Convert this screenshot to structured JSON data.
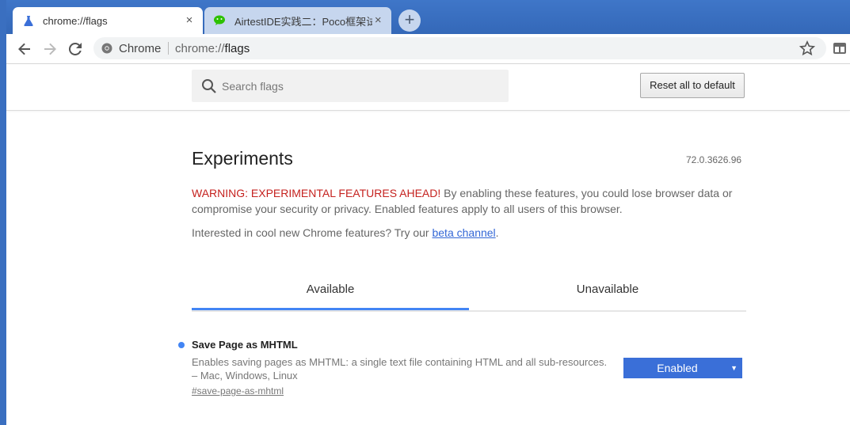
{
  "tabs": [
    {
      "title": "chrome://flags",
      "icon": "flask-icon",
      "close": "×"
    },
    {
      "title": "AirtestIDE实践二：Poco框架试用",
      "icon": "wechat-icon",
      "close": "×"
    }
  ],
  "new_tab": "+",
  "omnibox": {
    "site_label": "Chrome",
    "url_prefix": "chrome://",
    "url_path": "flags"
  },
  "search": {
    "placeholder": "Search flags",
    "value": ""
  },
  "reset_button": "Reset all to default",
  "page": {
    "title": "Experiments",
    "version": "72.0.3626.96",
    "warning_label": "WARNING: EXPERIMENTAL FEATURES AHEAD!",
    "warning_text": " By enabling these features, you could lose browser data or compromise your security or privacy. Enabled features apply to all users of this browser.",
    "interest_text": "Interested in cool new Chrome features? Try our ",
    "beta_link": "beta channel",
    "interest_end": "."
  },
  "flag_tabs": {
    "available": "Available",
    "unavailable": "Unavailable"
  },
  "experiment": {
    "name": "Save Page as MHTML",
    "description": "Enables saving pages as MHTML: a single text file containing HTML and all sub-resources.",
    "platforms": "– Mac, Windows, Linux",
    "link": "#save-page-as-mhtml",
    "selected": "Enabled",
    "arrow": "▼"
  },
  "colors": {
    "accent": "#4285f4",
    "warning": "#c5221f",
    "select_bg": "#3a6fd8",
    "titlebar": "#3f76c8"
  }
}
